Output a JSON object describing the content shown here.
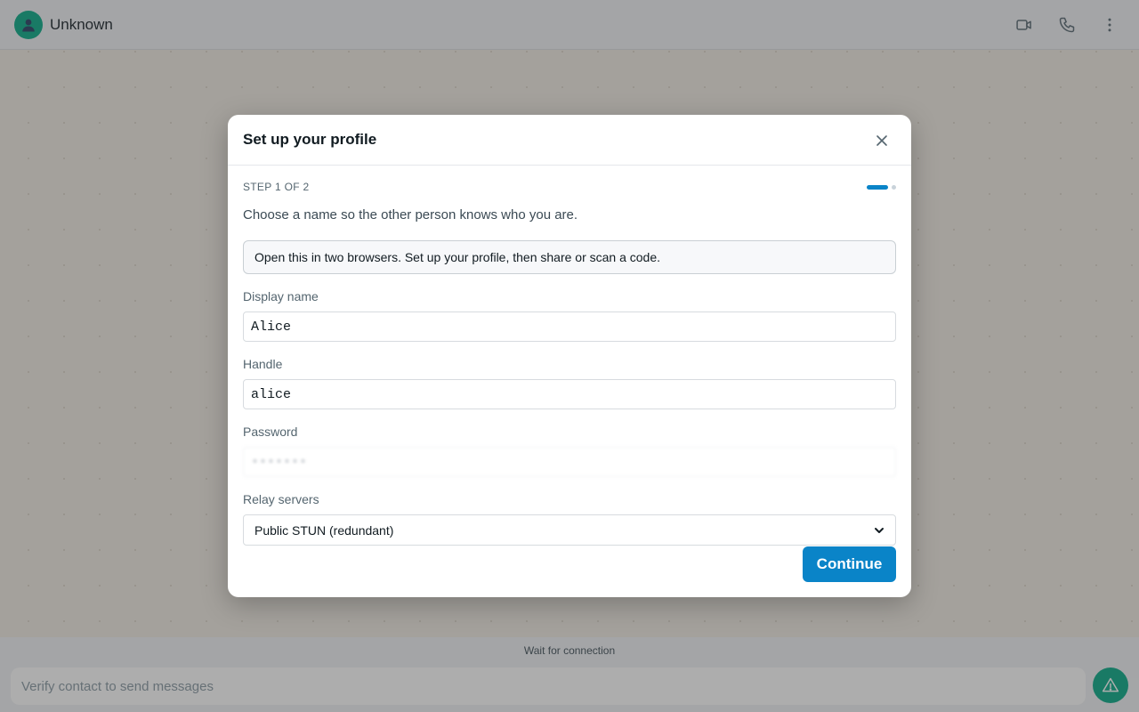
{
  "header": {
    "contact_name": "Unknown",
    "avatar_icon": "user-icon",
    "actions": [
      {
        "icon": "video-call-icon"
      },
      {
        "icon": "phone-call-icon"
      },
      {
        "icon": "more-vertical-icon"
      }
    ]
  },
  "footer": {
    "status": "Wait for connection",
    "composer_placeholder": "Verify contact to send messages",
    "warning_icon": "warning-triangle-icon"
  },
  "modal": {
    "title": "Set up your profile",
    "close_icon": "close-icon",
    "step_label": "STEP 1 OF 2",
    "step_current": 1,
    "step_total": 2,
    "intro": "Choose a name so the other person knows who you are.",
    "info": "Open this in two browsers. Set up your profile, then share or scan a code.",
    "fields": {
      "display_name": {
        "label": "Display name",
        "value": "Alice"
      },
      "handle": {
        "label": "Handle",
        "value": "alice"
      },
      "password": {
        "label": "Password",
        "value": "•••••••"
      },
      "relay": {
        "label": "Relay servers",
        "value": "Public STUN (redundant)"
      }
    },
    "continue_label": "Continue"
  },
  "colors": {
    "accent": "#0a84c8",
    "brand_green": "#00a884"
  }
}
